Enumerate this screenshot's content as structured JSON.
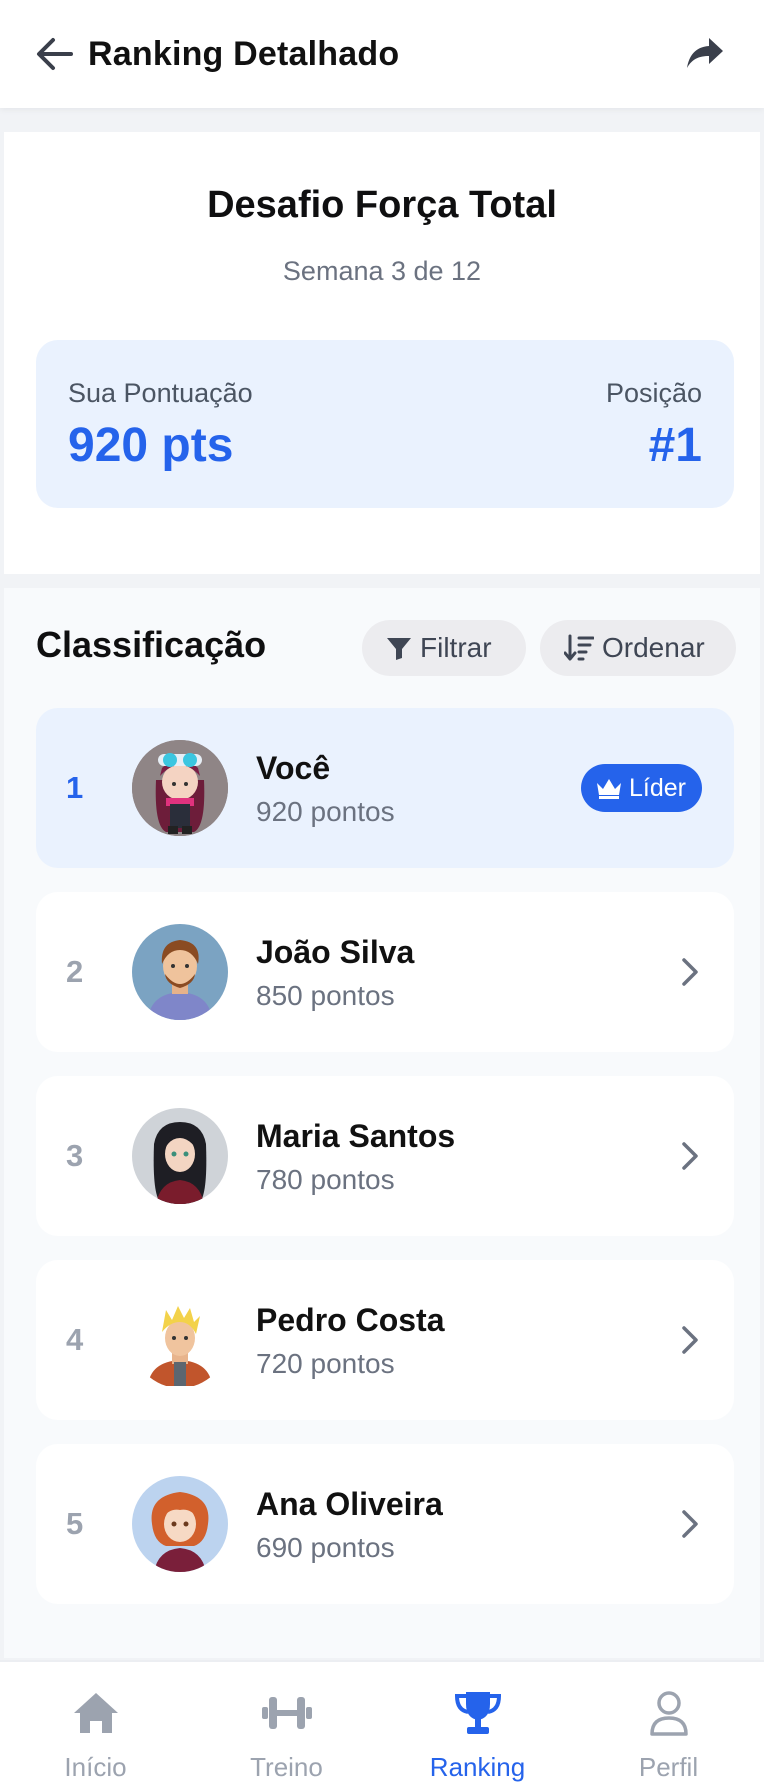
{
  "header": {
    "title": "Ranking Detalhado",
    "back_icon": "arrow-left-icon",
    "share_icon": "share-icon"
  },
  "challenge": {
    "title": "Desafio Força Total",
    "subtitle": "Semana 3 de 12",
    "score_label": "Sua Pontuação",
    "score_value": "920 pts",
    "position_label": "Posição",
    "position_value": "#1"
  },
  "classification": {
    "title": "Classificação",
    "filter_label": "Filtrar",
    "sort_label": "Ordenar",
    "rows": [
      {
        "rank": "1",
        "name": "Você",
        "points": "920 pontos",
        "badge": "Líder",
        "highlight": true
      },
      {
        "rank": "2",
        "name": "João Silva",
        "points": "850 pontos"
      },
      {
        "rank": "3",
        "name": "Maria Santos",
        "points": "780 pontos"
      },
      {
        "rank": "4",
        "name": "Pedro Costa",
        "points": "720 pontos"
      },
      {
        "rank": "5",
        "name": "Ana Oliveira",
        "points": "690 pontos"
      }
    ]
  },
  "nav": {
    "items": [
      {
        "label": "Início",
        "icon": "home-icon"
      },
      {
        "label": "Treino",
        "icon": "dumbbell-icon"
      },
      {
        "label": "Ranking",
        "icon": "trophy-icon",
        "active": true
      },
      {
        "label": "Perfil",
        "icon": "user-icon"
      }
    ]
  },
  "colors": {
    "accent": "#2563eb",
    "highlight_bg": "#eaf2fe",
    "muted_text": "#6b7280"
  }
}
